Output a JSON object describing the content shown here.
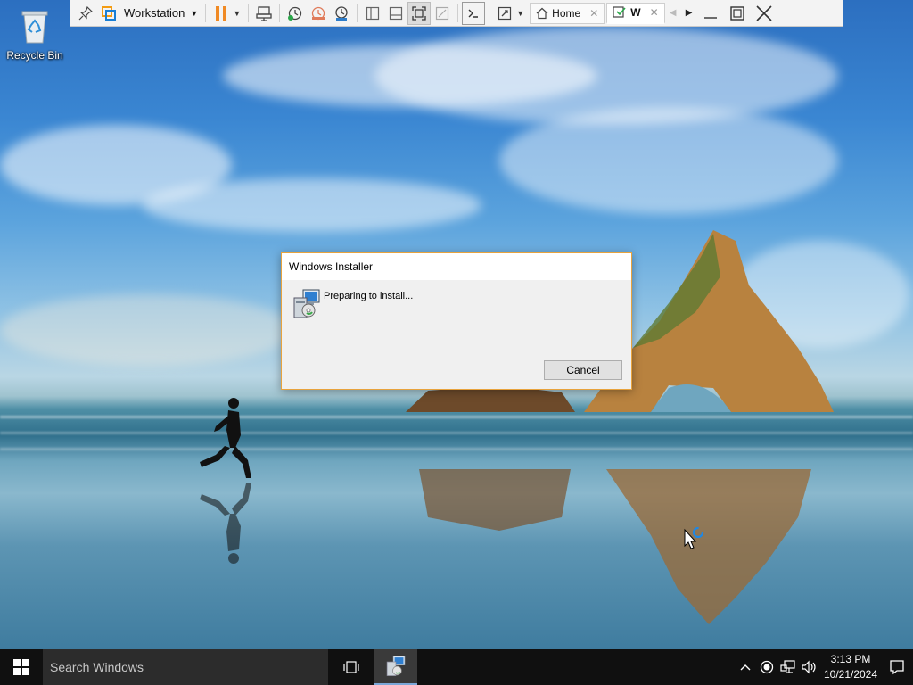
{
  "desktop": {
    "icons": [
      {
        "label": "Recycle Bin",
        "icon": "recycle-bin-icon"
      }
    ]
  },
  "vm_toolbar": {
    "menu_label": "Workstation",
    "tabs": [
      {
        "label": "Home",
        "icon": "home-icon"
      },
      {
        "label": "W",
        "icon": "vm-icon"
      }
    ],
    "icons": [
      "pin-icon",
      "vmware-logo-icon",
      "pause-icon",
      "send-keys-icon",
      "snapshot-take-icon",
      "snapshot-revert-icon",
      "snapshot-manager-icon",
      "library-icon",
      "thumbnail-icon",
      "fullscreen-icon",
      "unity-icon",
      "console-icon",
      "stretch-icon"
    ]
  },
  "dialog": {
    "title": "Windows Installer",
    "message": "Preparing to install...",
    "cancel_label": "Cancel",
    "icon": "installer-package-icon",
    "border_color": "#e8a33d"
  },
  "taskbar": {
    "search_placeholder": "Search Windows",
    "time": "3:13 PM",
    "date": "10/21/2024",
    "tray_icons": [
      "chevron-up-icon",
      "record-icon",
      "network-icon",
      "volume-icon",
      "notification-icon"
    ]
  }
}
